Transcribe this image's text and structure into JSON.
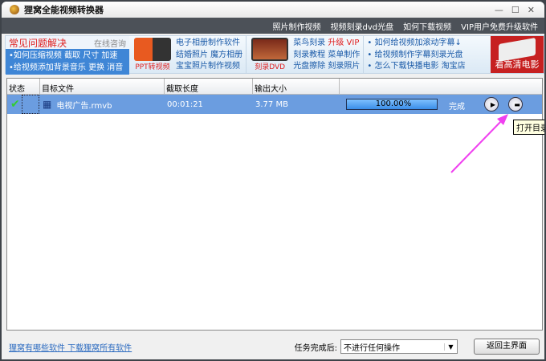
{
  "window": {
    "title": "狸窝全能视频转换器"
  },
  "menu": [
    "照片制作视频",
    "视频刻录dvd光盘",
    "如何下载视频",
    "VIP用户免费升级软件"
  ],
  "banner": {
    "faq_title": "常见问题解决",
    "faq_consult": "在线咨询",
    "faq_links": [
      "•如何压缩视频 截取 尺寸 加速",
      "•给视频添加背景音乐 更换 消音"
    ],
    "ppt_label": "PPT转视频",
    "album_links": [
      "电子相册制作软件",
      "结婚照片 魔方相册",
      "宝宝照片制作视频"
    ],
    "dvd_label": "刻录DVD",
    "burn_links": [
      "菜鸟刻录",
      "升级 VIP",
      "刻录教程 菜单制作",
      "光盘擦除 刻录照片"
    ],
    "tips": [
      "• 如何给视频加滚动字幕↓",
      "• 给视频制作字幕刻录光盘",
      "• 怎么下载快播电影 淘宝店"
    ],
    "ad_label": "看高清电影"
  },
  "table": {
    "headers": [
      "状态",
      "目标文件",
      "截取长度",
      "输出大小",
      ""
    ],
    "rows": [
      {
        "file": "电视广告.rmvb",
        "length": "00:01:21",
        "size": "3.77 MB",
        "progress": "100.00%",
        "progress_value": 100,
        "status": "完成"
      }
    ]
  },
  "tooltip": "打开目录",
  "footer": {
    "link": "狸窝有哪些软件 下载狸窝所有软件",
    "after_label": "任务完成后:",
    "after_value": "不进行任何操作",
    "back_button": "返回主界面"
  }
}
